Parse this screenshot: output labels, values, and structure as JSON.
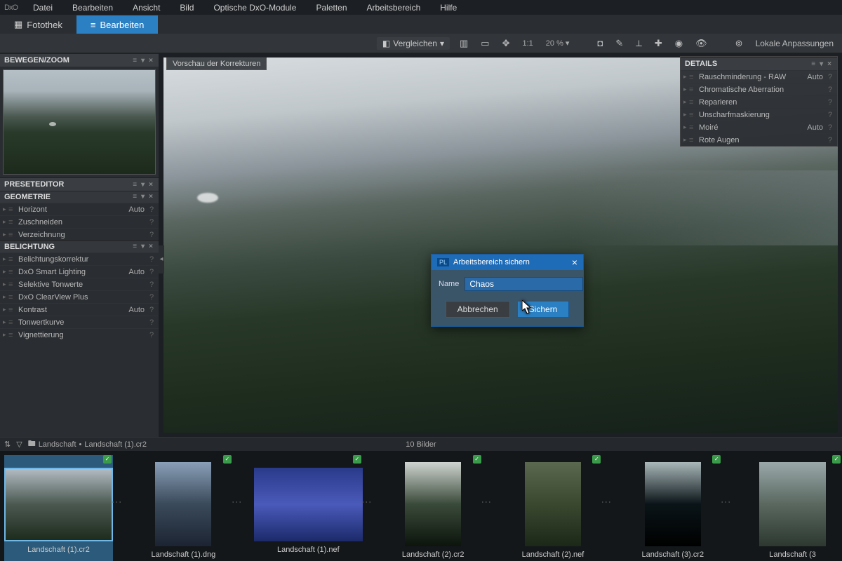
{
  "menubar": {
    "logo": "DxO",
    "items": [
      "Datei",
      "Bearbeiten",
      "Ansicht",
      "Bild",
      "Optische DxO-Module",
      "Paletten",
      "Arbeitsbereich",
      "Hilfe"
    ]
  },
  "tabs": {
    "library": "Fotothek",
    "edit": "Bearbeiten",
    "active": "edit"
  },
  "toolbar": {
    "compare": "Vergleichen",
    "one_to_one": "1:1",
    "zoom": "20 %",
    "local_adjust": "Lokale Anpassungen"
  },
  "preview_chip": "Vorschau der Korrekturen",
  "left_panels": {
    "move_zoom": "BEWEGEN/ZOOM",
    "preset_editor": "PRESETEDITOR",
    "geometry": {
      "title": "GEOMETRIE",
      "rows": [
        {
          "label": "Horizont",
          "auto": "Auto"
        },
        {
          "label": "Zuschneiden"
        },
        {
          "label": "Verzeichnung"
        }
      ]
    },
    "exposure": {
      "title": "BELICHTUNG",
      "rows": [
        {
          "label": "Belichtungskorrektur"
        },
        {
          "label": "DxO Smart Lighting",
          "auto": "Auto"
        },
        {
          "label": "Selektive Tonwerte"
        },
        {
          "label": "DxO ClearView Plus"
        },
        {
          "label": "Kontrast",
          "auto": "Auto"
        },
        {
          "label": "Tonwertkurve"
        },
        {
          "label": "Vignettierung"
        }
      ]
    }
  },
  "right_panel": {
    "title": "DETAILS",
    "rows": [
      {
        "label": "Rauschminderung - RAW",
        "auto": "Auto"
      },
      {
        "label": "Chromatische Aberration"
      },
      {
        "label": "Reparieren"
      },
      {
        "label": "Unscharfmaskierung"
      },
      {
        "label": "Moiré",
        "auto": "Auto"
      },
      {
        "label": "Rote Augen"
      }
    ]
  },
  "path": {
    "folder": "Landschaft",
    "file": "Landschaft (1).cr2"
  },
  "filmstrip": {
    "count": "10 Bilder",
    "thumbs": [
      {
        "name": "Landschaft (1).cr2"
      },
      {
        "name": "Landschaft (1).dng"
      },
      {
        "name": "Landschaft (1).nef"
      },
      {
        "name": "Landschaft (2).cr2"
      },
      {
        "name": "Landschaft (2).nef"
      },
      {
        "name": "Landschaft (3).cr2"
      },
      {
        "name": "Landschaft (3"
      }
    ]
  },
  "dialog": {
    "title": "Arbeitsbereich sichern",
    "name_label": "Name",
    "name_value": "Chaos",
    "cancel": "Abbrechen",
    "save": "Sichern"
  }
}
